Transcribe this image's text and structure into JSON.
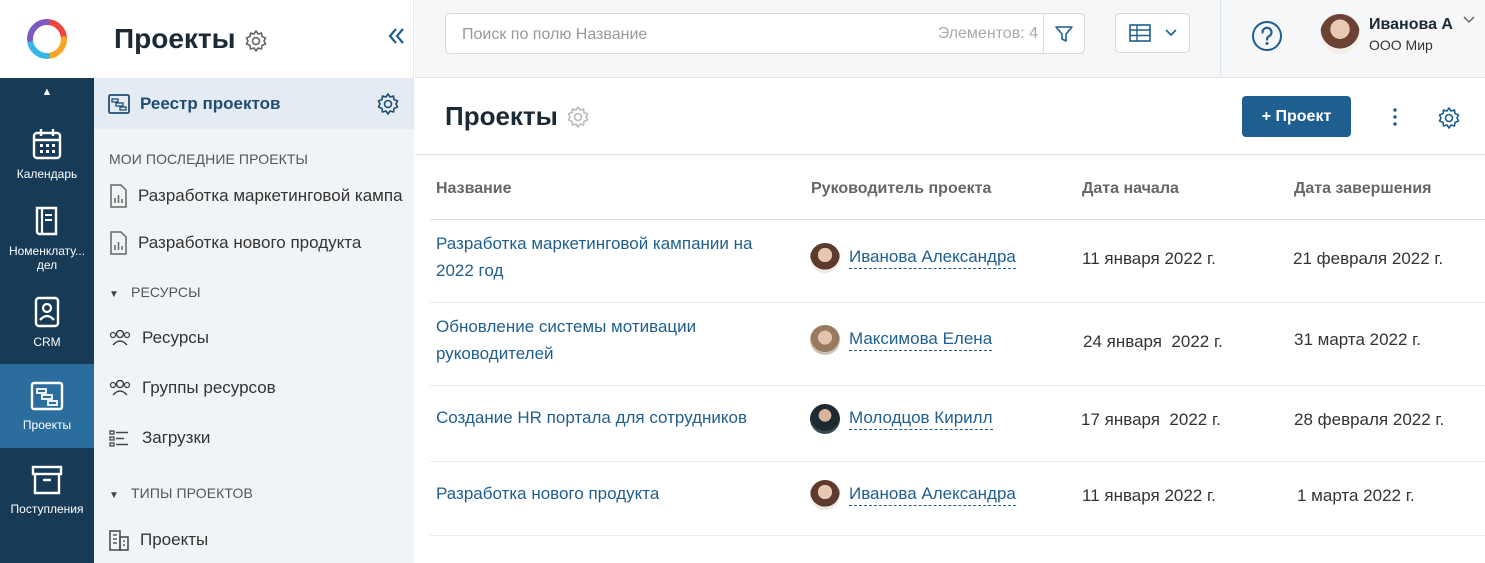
{
  "colors": {
    "rail": "#173b57",
    "rail_active": "#2b6e9e",
    "accent": "#1f5f8f",
    "side_bg": "#f1f4f7"
  },
  "rail": {
    "items": [
      {
        "label": "Календарь",
        "icon": "calendar-icon"
      },
      {
        "label": "Номенклату... дел",
        "icon": "book-icon"
      },
      {
        "label": "CRM",
        "icon": "crm-icon"
      },
      {
        "label": "Проекты",
        "icon": "projects-icon",
        "active": true
      },
      {
        "label": "Поступления",
        "icon": "archive-icon"
      }
    ]
  },
  "side": {
    "title": "Проекты",
    "registry_label": "Реестр проектов",
    "recent_header": "МОИ ПОСЛЕДНИЕ ПРОЕКТЫ",
    "recent": [
      "Разработка маркетинговой кампа",
      "Разработка нового продукта"
    ],
    "resources_header": "РЕСУРСЫ",
    "resources": [
      "Ресурсы",
      "Группы ресурсов",
      "Загрузки"
    ],
    "types_header": "ТИПЫ ПРОЕКТОВ",
    "types": [
      "Проекты"
    ]
  },
  "topbar": {
    "search_placeholder": "Поиск по полю Название",
    "count": "Элементов: 4",
    "user_name": "Иванова А",
    "user_org": "ООО Мир"
  },
  "main": {
    "title": "Проекты",
    "add_button": "+ Проект",
    "columns": [
      "Название",
      "Руководитель проекта",
      "Дата начала",
      "Дата завершения"
    ],
    "rows": [
      {
        "name": "Разработка маркетинговой кампании на 2022 год",
        "manager": "Иванова Александра",
        "start": "11 января 2022 г.",
        "end": "21 февраля 2022 г."
      },
      {
        "name": "Обновление системы мотивации руководителей",
        "manager": "Максимова Елена",
        "start": "24 января  2022 г.",
        "end": "31 марта 2022 г."
      },
      {
        "name": "Создание HR портала для сотрудников",
        "manager": "Молодцов Кирилл",
        "start": "17 января  2022 г.",
        "end": "28 февраля 2022 г."
      },
      {
        "name": "Разработка нового продукта",
        "manager": "Иванова Александра",
        "start": "11 января 2022 г.",
        "end": "1 марта 2022 г."
      }
    ]
  }
}
